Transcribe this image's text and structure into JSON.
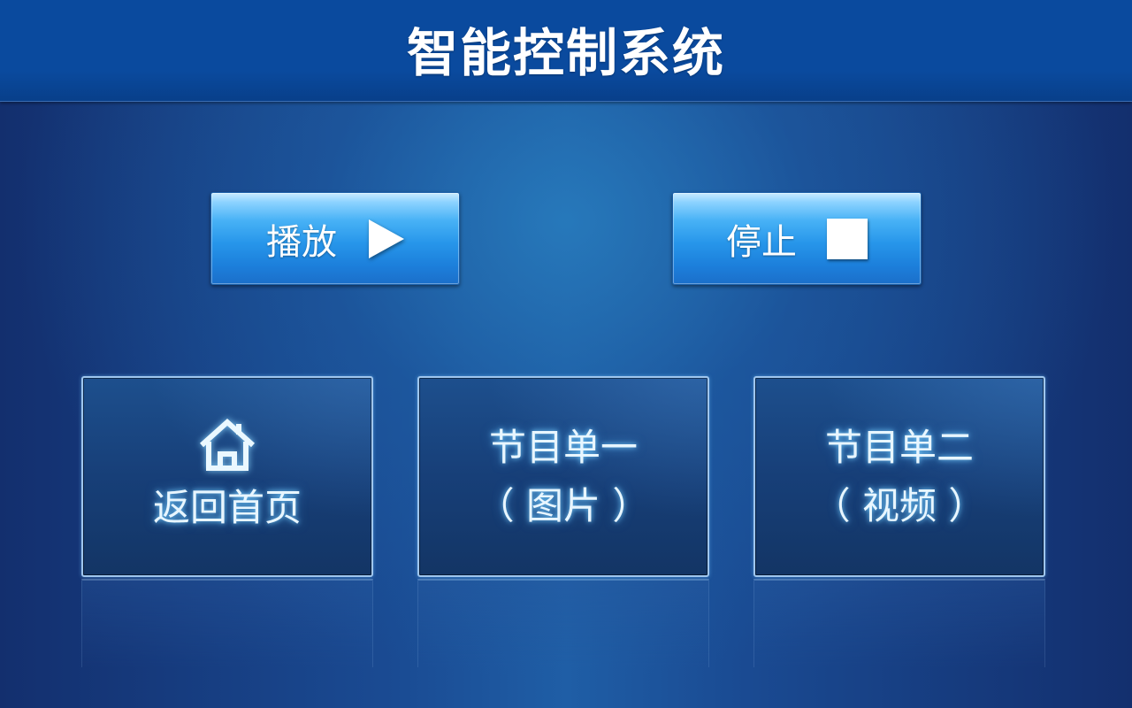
{
  "header": {
    "title": "智能控制系统"
  },
  "controls": {
    "play": {
      "label": "播放",
      "icon": "play-icon"
    },
    "stop": {
      "label": "停止",
      "icon": "stop-icon"
    }
  },
  "cards": [
    {
      "icon": "home-icon",
      "label": "返回首页"
    },
    {
      "line1": "节目单一",
      "line2": "（ 图片 ）"
    },
    {
      "line1": "节目单二",
      "line2": "（ 视频 ）"
    }
  ],
  "colors": {
    "header_bg": "#0a4a9e",
    "button_accent": "#2796ea",
    "card_glow": "#78d2ff",
    "background": "#1a4b93"
  }
}
